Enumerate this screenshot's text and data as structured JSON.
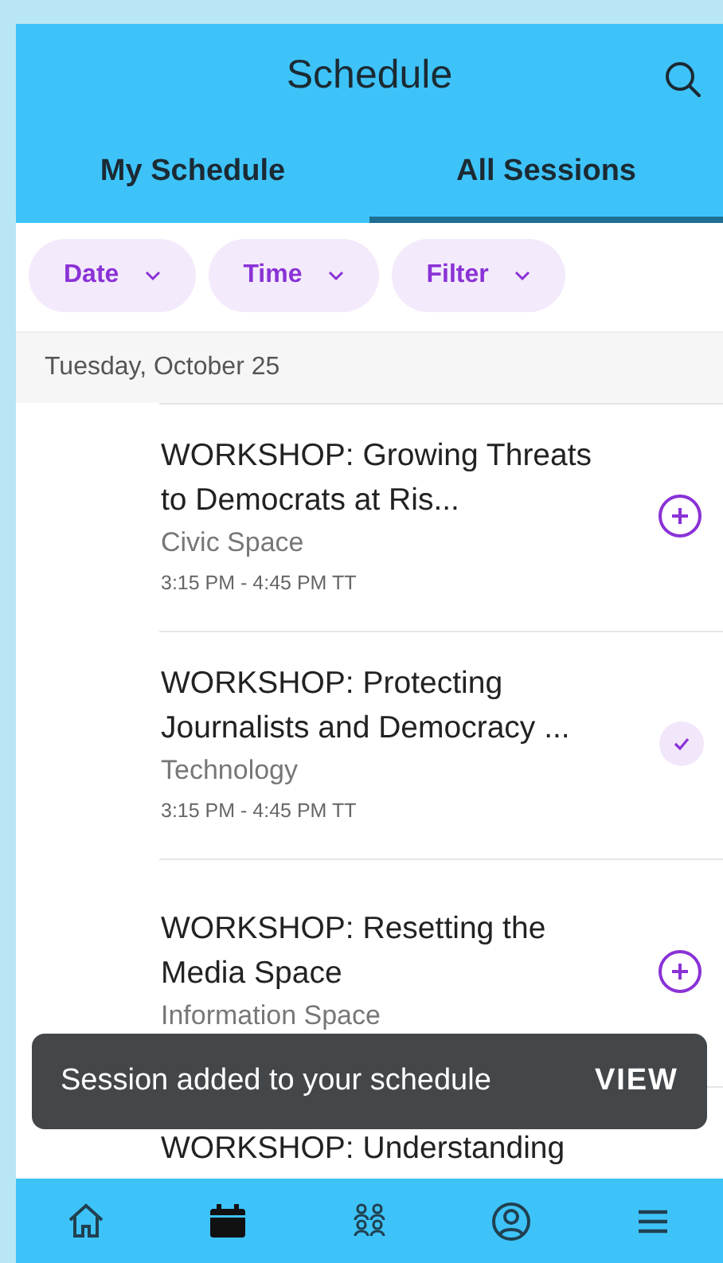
{
  "header": {
    "title": "Schedule"
  },
  "tabs": [
    {
      "label": "My Schedule",
      "selected": false
    },
    {
      "label": "All Sessions",
      "selected": true
    }
  ],
  "filters": [
    {
      "label": "Date"
    },
    {
      "label": "Time"
    },
    {
      "label": "Filter"
    }
  ],
  "date_header": "Tuesday, October 25",
  "sessions": [
    {
      "title": "WORKSHOP: Growing Threats to Democrats at Ris...",
      "category": "Civic Space",
      "time": "3:15 PM - 4:45 PM TT",
      "added": false
    },
    {
      "title": "WORKSHOP: Protecting Journalists and Democracy ...",
      "category": "Technology",
      "time": "3:15 PM - 4:45 PM TT",
      "added": true
    },
    {
      "title": "WORKSHOP: Resetting the Media Space",
      "category": "Information Space",
      "added": false
    },
    {
      "title": "WORKSHOP: Understanding"
    }
  ],
  "toast": {
    "message": "Session added to your schedule",
    "action": "VIEW"
  },
  "bottom_nav": [
    {
      "kind": "home",
      "selected": false
    },
    {
      "kind": "calendar",
      "selected": true
    },
    {
      "kind": "people",
      "selected": false
    },
    {
      "kind": "profile",
      "selected": false
    },
    {
      "kind": "menu",
      "selected": false
    }
  ]
}
